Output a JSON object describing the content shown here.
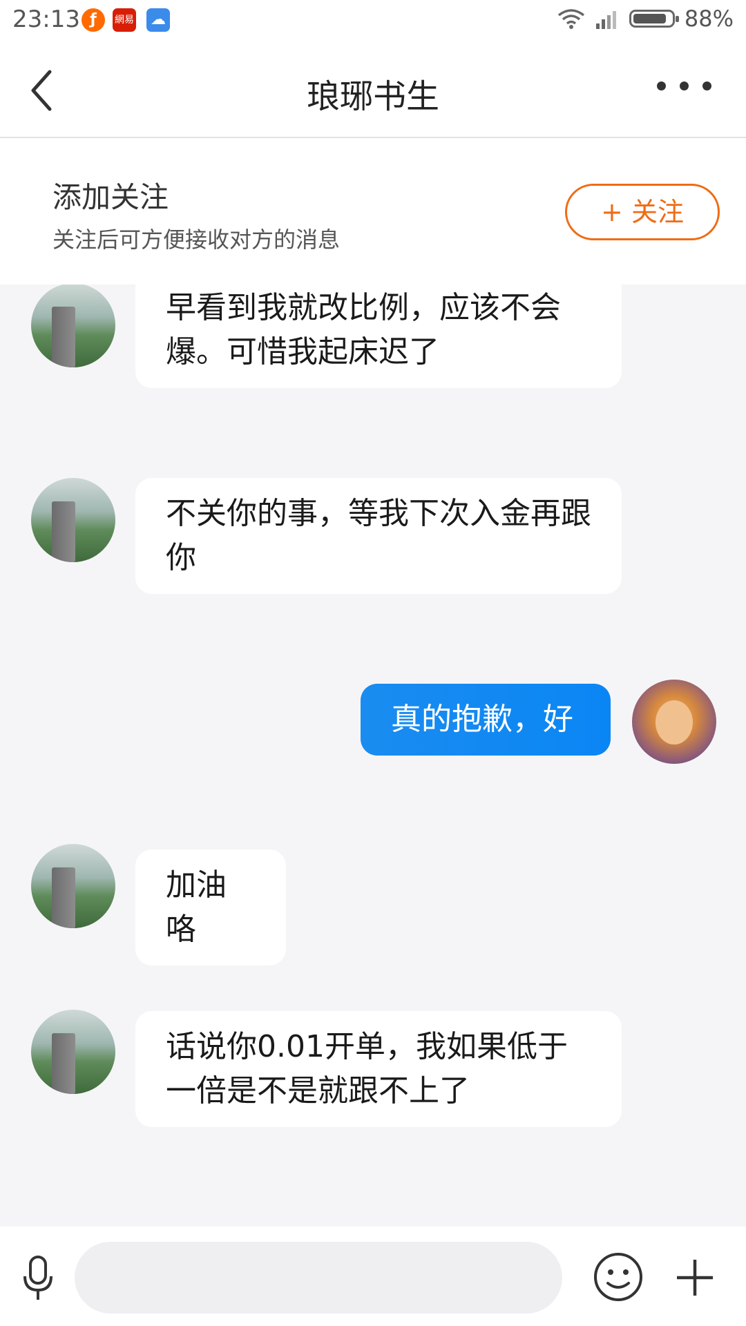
{
  "status_bar": {
    "time": "23:13",
    "app_icons": [
      "flame-app-icon",
      "netease-app-icon",
      "cloud-app-icon"
    ],
    "battery": "88%",
    "battery_level": 0.88
  },
  "navbar": {
    "title": "琅琊书生",
    "back_icon": "chevron-left-icon",
    "more_icon": "more-dots-icon"
  },
  "follow_banner": {
    "title": "添加关注",
    "subtitle": "关注后可方便接收对方的消息",
    "button_label": "+ 关注"
  },
  "messages": [
    {
      "sender": "peer",
      "text": "早看到我就改比例，应该不会爆。可惜我起床迟了"
    },
    {
      "sender": "peer",
      "text": "不关你的事，等我下次入金再跟你"
    },
    {
      "sender": "self",
      "text": "真的抱歉，好"
    },
    {
      "sender": "peer",
      "text": "加油咯"
    },
    {
      "sender": "peer",
      "text": "话说你0.01开单，我如果低于一倍是不是就跟不上了"
    }
  ],
  "input_bar": {
    "placeholder": "",
    "mic_icon": "microphone-icon",
    "emoji_icon": "emoji-icon",
    "plus_icon": "plus-icon"
  },
  "colors": {
    "accent_orange": "#ef6c14",
    "self_bubble_blue": "#0a86f4",
    "background": "#f5f5f7"
  }
}
